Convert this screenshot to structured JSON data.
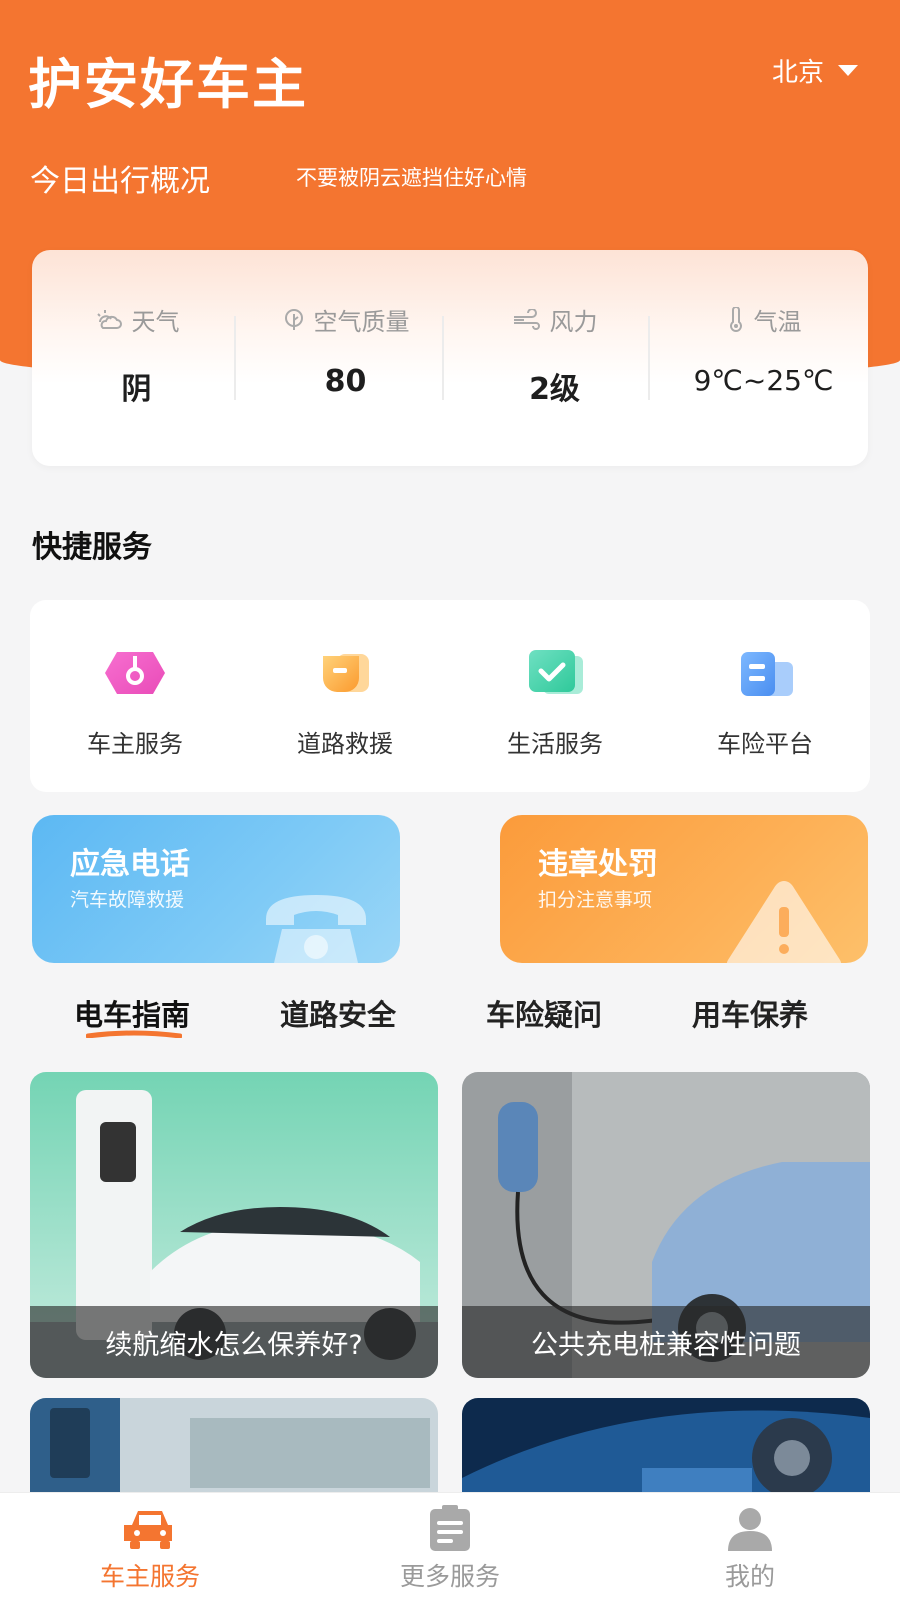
{
  "header": {
    "app_title": "护安好车主",
    "city": "北京",
    "today_title": "今日出行概况",
    "today_subtitle": "不要被阴云遮挡住好心情"
  },
  "weather": {
    "items": [
      {
        "label": "天气",
        "value": "阴",
        "icon": "cloudy-sun-icon"
      },
      {
        "label": "空气质量",
        "value": "80",
        "icon": "leaf-icon"
      },
      {
        "label": "风力",
        "value": "2级",
        "icon": "wind-icon"
      },
      {
        "label": "气温",
        "value": "9℃~25℃",
        "icon": "thermometer-icon"
      }
    ]
  },
  "quick_services": {
    "title": "快捷服务",
    "items": [
      {
        "label": "车主服务",
        "icon": "owner-service-icon"
      },
      {
        "label": "道路救援",
        "icon": "road-rescue-icon"
      },
      {
        "label": "生活服务",
        "icon": "life-service-icon"
      },
      {
        "label": "车险平台",
        "icon": "insurance-platform-icon"
      }
    ]
  },
  "banners": {
    "emergency": {
      "title": "应急电话",
      "subtitle": "汽车故障救援",
      "icon": "telephone-icon"
    },
    "violation": {
      "title": "违章处罚",
      "subtitle": "扣分注意事项",
      "icon": "warning-icon"
    }
  },
  "tabs": [
    {
      "label": "电车指南",
      "active": true
    },
    {
      "label": "道路安全",
      "active": false
    },
    {
      "label": "车险疑问",
      "active": false
    },
    {
      "label": "用车保养",
      "active": false
    }
  ],
  "articles": [
    {
      "caption": "续航缩水怎么保养好?"
    },
    {
      "caption": "公共充电桩兼容性问题"
    }
  ],
  "bottom_nav": [
    {
      "label": "车主服务",
      "icon": "car-icon",
      "active": true
    },
    {
      "label": "更多服务",
      "icon": "clipboard-icon",
      "active": false
    },
    {
      "label": "我的",
      "icon": "user-icon",
      "active": false
    }
  ],
  "colors": {
    "brand": "#f47530",
    "banner_blue": "#5cb8f3",
    "banner_orange": "#fb9b3b"
  }
}
